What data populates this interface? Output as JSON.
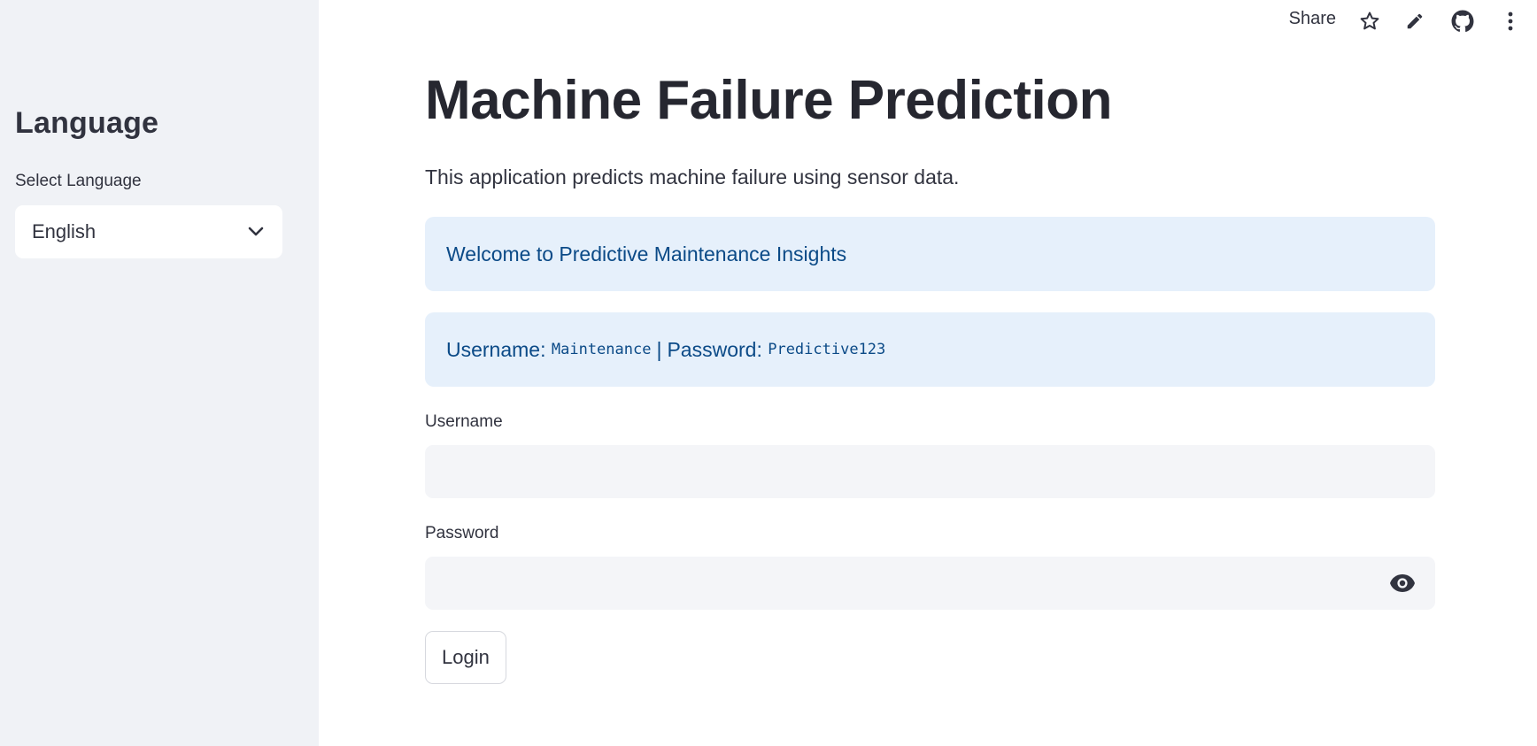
{
  "sidebar": {
    "heading": "Language",
    "select_label": "Select Language",
    "select_value": "English"
  },
  "toolbar": {
    "share_label": "Share",
    "icons": [
      "star-icon",
      "pencil-icon",
      "github-icon",
      "more-vertical-icon"
    ]
  },
  "main": {
    "title": "Machine Failure Prediction",
    "description": "This application predicts machine failure using sensor data.",
    "welcome_message": "Welcome to Predictive Maintenance Insights",
    "credentials": {
      "username_label": "Username:",
      "username_value": "Maintenance",
      "separator": "|",
      "password_label": "Password:",
      "password_value": "Predictive123"
    },
    "username_field_label": "Username",
    "username_value": "",
    "password_field_label": "Password",
    "password_value": "",
    "login_label": "Login"
  },
  "colors": {
    "sidebar_bg": "#f0f2f6",
    "info_bg": "#e6f0fb",
    "info_text": "#0b4a87",
    "input_bg": "#f4f5f8"
  }
}
